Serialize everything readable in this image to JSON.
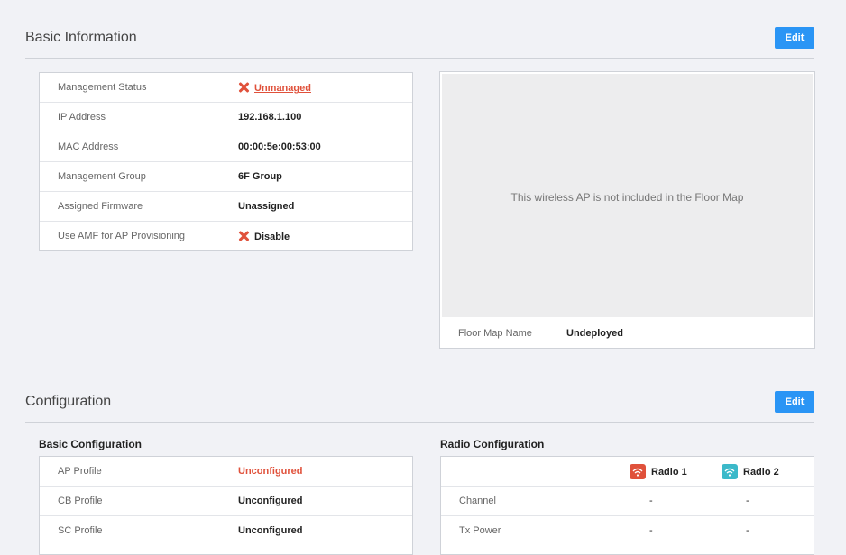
{
  "basic_info": {
    "title": "Basic Information",
    "edit_label": "Edit",
    "rows": [
      {
        "label": "Management Status",
        "value": "Unmanaged"
      },
      {
        "label": "IP Address",
        "value": "192.168.1.100"
      },
      {
        "label": "MAC Address",
        "value": "00:00:5e:00:53:00"
      },
      {
        "label": "Management Group",
        "value": "6F Group"
      },
      {
        "label": "Assigned Firmware",
        "value": "Unassigned"
      },
      {
        "label": "Use AMF for AP Provisioning",
        "value": "Disable"
      }
    ],
    "floor_map": {
      "message": "This wireless AP is not included in the Floor Map",
      "name_label": "Floor Map Name",
      "name_value": "Undeployed"
    }
  },
  "configuration": {
    "title": "Configuration",
    "edit_label": "Edit",
    "basic": {
      "title": "Basic Configuration",
      "rows": [
        {
          "label": "AP Profile",
          "value": "Unconfigured"
        },
        {
          "label": "CB Profile",
          "value": "Unconfigured"
        },
        {
          "label": "SC Profile",
          "value": "Unconfigured"
        }
      ]
    },
    "radio": {
      "title": "Radio Configuration",
      "radio1": {
        "label": "Radio 1",
        "icon": "wifi-icon",
        "color": "#e0513b"
      },
      "radio2": {
        "label": "Radio 2",
        "icon": "wifi-icon",
        "color": "#3bb9c9"
      },
      "rows": [
        {
          "label": "Channel",
          "r1": "-",
          "r2": "-"
        },
        {
          "label": "Tx Power",
          "r1": "-",
          "r2": "-"
        }
      ]
    }
  },
  "colors": {
    "accent": "#2a95f5",
    "error": "#e0513b",
    "background": "#f1f2f6"
  }
}
